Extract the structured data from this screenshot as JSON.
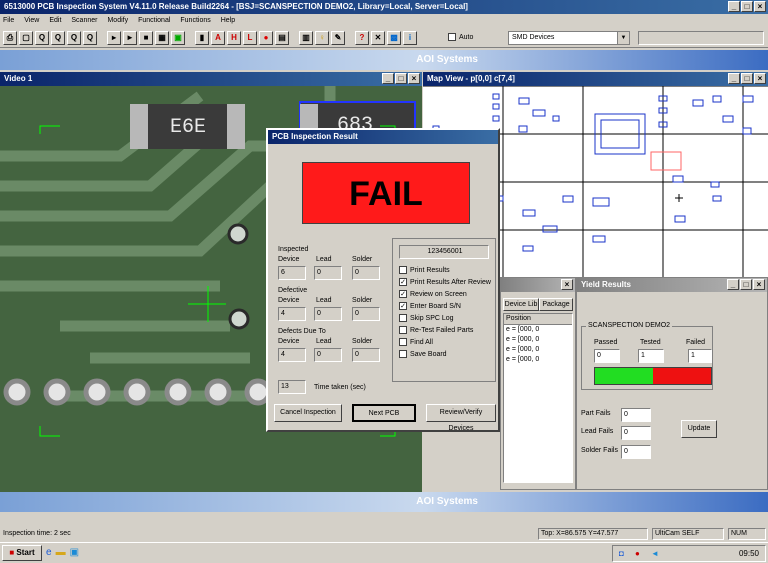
{
  "app": {
    "title": "6513000 PCB Inspection System V4.11.0 Release Build2264 - [BSJ=SCANSPECTION DEMO2, Library=Local, Server=Local]",
    "menu": [
      "File",
      "View",
      "Edit",
      "Scanner",
      "Modify",
      "Functional",
      "Functions",
      "Help"
    ],
    "auto_label": "Auto",
    "device_select": "SMD Devices",
    "banner": "AOI Systems"
  },
  "toolbar": {
    "icons": [
      "printer-icon",
      "frame-icon",
      "zoom-icon",
      "zoom-in-icon",
      "zoom-out-icon",
      "zoom-fit-icon",
      "arrow-icon",
      "play-icon",
      "stop-icon",
      "grid-icon",
      "green-icon",
      "black-icon",
      "a-icon",
      "h-icon",
      "l-icon",
      "record-icon",
      "table-icon",
      "list-icon",
      "lamp-icon",
      "pencil-icon",
      "q-icon",
      "tool-icon",
      "camera-icon",
      "info-icon"
    ]
  },
  "video": {
    "title": "Video 1",
    "chip_labels": [
      "E6E",
      "683"
    ]
  },
  "mapview": {
    "title": "Map View - p[0,0] c[7,4]"
  },
  "device_panel": {
    "tabs": [
      "Device Lib",
      "Package"
    ],
    "column": "Position",
    "rows": [
      "e = [000, 0",
      "e = [000, 0",
      "e = [000, 0",
      "e = [000, 0"
    ]
  },
  "dialog": {
    "title": "PCB Inspection Result",
    "result": "FAIL",
    "barcode": "123456001",
    "inspected_label": "Inspected",
    "defective_label": "Defective",
    "defects_due_to_label": "Defects Due To",
    "col_device": "Device",
    "col_lead": "Lead",
    "col_solder": "Solder",
    "inspected": [
      "6",
      "0",
      "0"
    ],
    "defective": [
      "4",
      "0",
      "0"
    ],
    "defects_due": [
      "4",
      "0",
      "0"
    ],
    "time_value": "13",
    "time_label": "Time taken (sec)",
    "options": [
      {
        "label": "Print Results",
        "checked": false
      },
      {
        "label": "Print Results After Review",
        "checked": true
      },
      {
        "label": "Review on Screen",
        "checked": true
      },
      {
        "label": "Enter Board S/N",
        "checked": true
      },
      {
        "label": "Skip SPC Log",
        "checked": false
      },
      {
        "label": "Re-Test Failed Parts",
        "checked": false
      },
      {
        "label": "Find All",
        "checked": false
      },
      {
        "label": "Save Board",
        "checked": false
      }
    ],
    "btn_cancel": "Cancel Inspection",
    "btn_next": "Next PCB",
    "btn_review": "Review/Verify Devices"
  },
  "yield": {
    "title": "Yield Results",
    "group": "SCANSPECTION DEMO2",
    "passed_label": "Passed",
    "tested_label": "Tested",
    "failed_label": "Failed",
    "passed": "0",
    "tested": "1",
    "failed": "1",
    "pass_fraction": 0.5,
    "pass_color": "#22dd22",
    "fail_color": "#ee1111",
    "part_fails_label": "Part Fails",
    "lead_fails_label": "Lead Fails",
    "solder_fails_label": "Solder Fails",
    "part_fails": "0",
    "lead_fails": "0",
    "solder_fails": "0",
    "update": "Update"
  },
  "status": {
    "left": "Inspection time: 2 sec",
    "coords": "Top: X=86.575 Y=47.577",
    "user": "UltiCam SELF",
    "mode": "NUM"
  },
  "taskbar": {
    "start": "Start",
    "clock": "09:50"
  }
}
